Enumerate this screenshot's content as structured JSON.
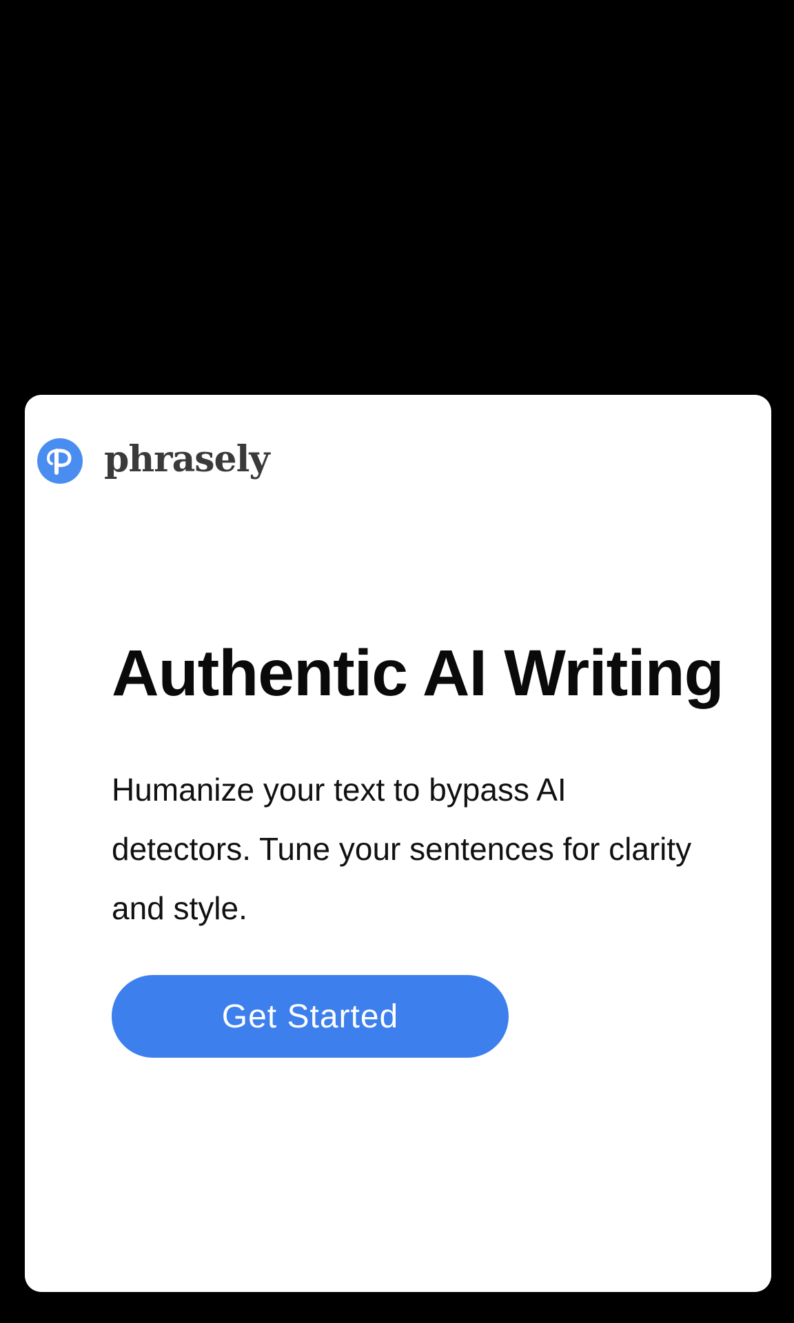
{
  "brand": {
    "name": "phrasely",
    "logo_icon": "phrasely-p-logo-icon",
    "logo_color": "#4a8df0"
  },
  "hero": {
    "headline": "Authentic AI Writing",
    "subtext": "Humanize your text to bypass AI detectors. Tune your sentences for clarity and style.",
    "cta_label": "Get Started"
  },
  "colors": {
    "background": "#000000",
    "card": "#ffffff",
    "accent": "#3d7fed"
  }
}
